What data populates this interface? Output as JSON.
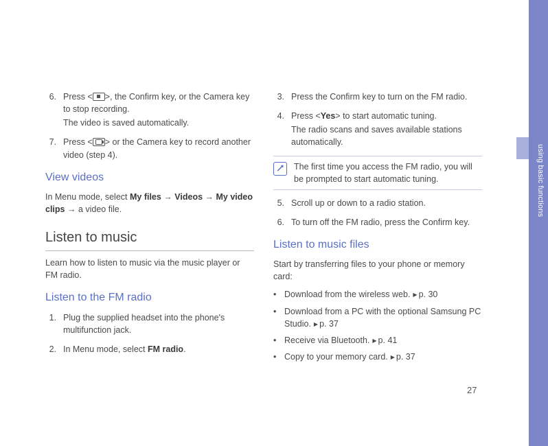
{
  "pageNumber": "27",
  "sideLabel": "using basic functions",
  "col1": {
    "step6_a": "Press <",
    "step6_b": ">, the Confirm key, or the Camera key to stop recording.",
    "step6_sub": "The video is saved automatically.",
    "step7_a": "Press <",
    "step7_b": "> or the Camera key to record another video (step 4).",
    "viewVideosHead": "View videos",
    "viewVideos_a": "In Menu mode, select ",
    "viewVideos_b1": "My files",
    "viewVideos_arrow": " → ",
    "viewVideos_b2": "Videos",
    "viewVideos_b3": "My video clips",
    "viewVideos_c": " → a video file.",
    "listenHead": "Listen to music",
    "listenPara": "Learn how to listen to music via the music player or FM radio.",
    "fmHead": "Listen to the FM radio",
    "fm1": "Plug the supplied headset into the phone's multifunction jack.",
    "fm2_a": "In Menu mode, select ",
    "fm2_b": "FM radio",
    "fm2_c": "."
  },
  "col2": {
    "fm3": "Press the Confirm key to turn on the FM radio.",
    "fm4_a": "Press <",
    "fm4_b": "Yes",
    "fm4_c": "> to start automatic tuning.",
    "fm4_sub": "The radio scans and saves available stations automatically.",
    "note": "The first time you access the FM radio, you will be prompted to start automatic tuning.",
    "fm5": "Scroll up or down to a radio station.",
    "fm6": "To turn off the FM radio, press the Confirm key.",
    "musicFilesHead": "Listen to music files",
    "musicPara": "Start by transferring files to your phone or memory card:",
    "b1_a": "Download from the wireless web.",
    "b1_ref": "p. 30",
    "b2_a": "Download from a PC with the optional Samsung PC Studio.",
    "b2_ref": "p. 37",
    "b3_a": "Receive via Bluetooth.",
    "b3_ref": "p. 41",
    "b4_a": "Copy to your memory card.",
    "b4_ref": "p. 37"
  }
}
